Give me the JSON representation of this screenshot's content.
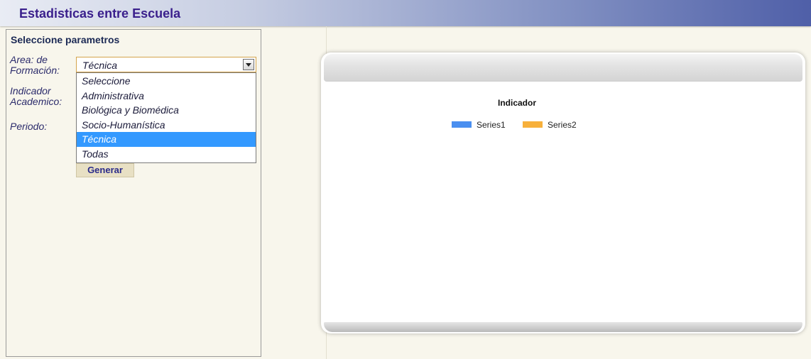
{
  "header": {
    "title": "Estadisticas entre Escuela"
  },
  "panel": {
    "title": "Seleccione parametros",
    "labels": {
      "area": "Area: de Formación:",
      "indicador": "Indicador Academico:",
      "periodo": "Periodo:"
    },
    "area_select": {
      "value": "Técnica",
      "options": [
        "Seleccione",
        "Administrativa",
        "Biológica y Biomédica",
        "Socio-Humanística",
        "Técnica",
        "Todas"
      ],
      "highlighted_index": 4
    },
    "generate_label": "Generar"
  },
  "chart_data": {
    "type": "bar",
    "title": "Indicador",
    "categories": [],
    "series": [
      {
        "name": "Series1",
        "color": "#4a8ff0",
        "values": []
      },
      {
        "name": "Series2",
        "color": "#f7b03b",
        "values": []
      }
    ],
    "xlabel": "",
    "ylabel": "",
    "legend": "top-center"
  }
}
